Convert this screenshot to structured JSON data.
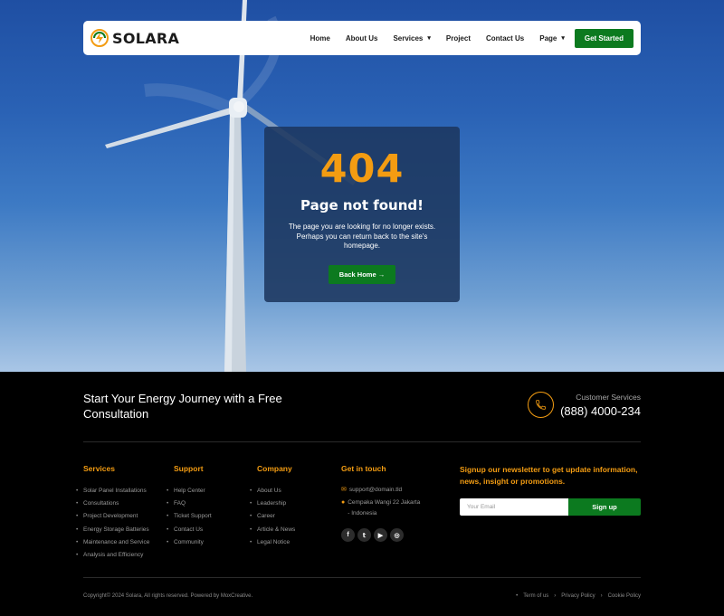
{
  "brand": {
    "name": "SOLARA"
  },
  "nav": {
    "items": [
      {
        "label": "Home",
        "has_dropdown": false
      },
      {
        "label": "About Us",
        "has_dropdown": false
      },
      {
        "label": "Services",
        "has_dropdown": true
      },
      {
        "label": "Project",
        "has_dropdown": false
      },
      {
        "label": "Contact Us",
        "has_dropdown": false
      },
      {
        "label": "Page",
        "has_dropdown": true
      }
    ],
    "cta_label": "Get Started"
  },
  "error": {
    "code": "404",
    "title": "Page not found!",
    "description": "The page you are looking for no longer exists. Perhaps you can return back to the site's homepage.",
    "button_label": "Back Home →"
  },
  "footer": {
    "headline": "Start Your Energy Journey with a Free Consultation",
    "customer_services": {
      "label": "Customer Services",
      "phone": "(888) 4000-234"
    },
    "columns": {
      "services": {
        "title": "Services",
        "items": [
          "Solar Panel Installations",
          "Consultations",
          "Project Development",
          "Energy Storage Batteries",
          "Maintenance and Service",
          "Analysis and Efficiency"
        ]
      },
      "support": {
        "title": "Support",
        "items": [
          "Help Center",
          "FAQ",
          "Ticket Support",
          "Contact Us",
          "Community"
        ]
      },
      "company": {
        "title": "Company",
        "items": [
          "About Us",
          "Leadership",
          "Career",
          "Article & News",
          "Legal Notice"
        ]
      },
      "contact": {
        "title": "Get in touch",
        "email": "support@domain.tld",
        "address": "Cempaka Wangi 22 Jakarta - Indonesia"
      }
    },
    "newsletter": {
      "title": "Signup our newsletter to get update information, news, insight or promotions.",
      "placeholder": "Your Email",
      "button_label": "Sign up"
    },
    "copyright": "Copyright© 2024 Solara, All rights reserved. Powered by MoxCreative.",
    "legal_links": [
      "Term of us",
      "Privacy Policy",
      "Cookie Policy"
    ]
  },
  "colors": {
    "accent": "#f39c12",
    "brand_green": "#0c7a1f",
    "card_bg": "#1c375e"
  },
  "icons": [
    "logo-bolt-icon",
    "chevron-down-icon",
    "phone-icon",
    "email-icon",
    "location-pin-icon",
    "facebook-icon",
    "twitter-icon",
    "youtube-icon",
    "instagram-icon"
  ]
}
